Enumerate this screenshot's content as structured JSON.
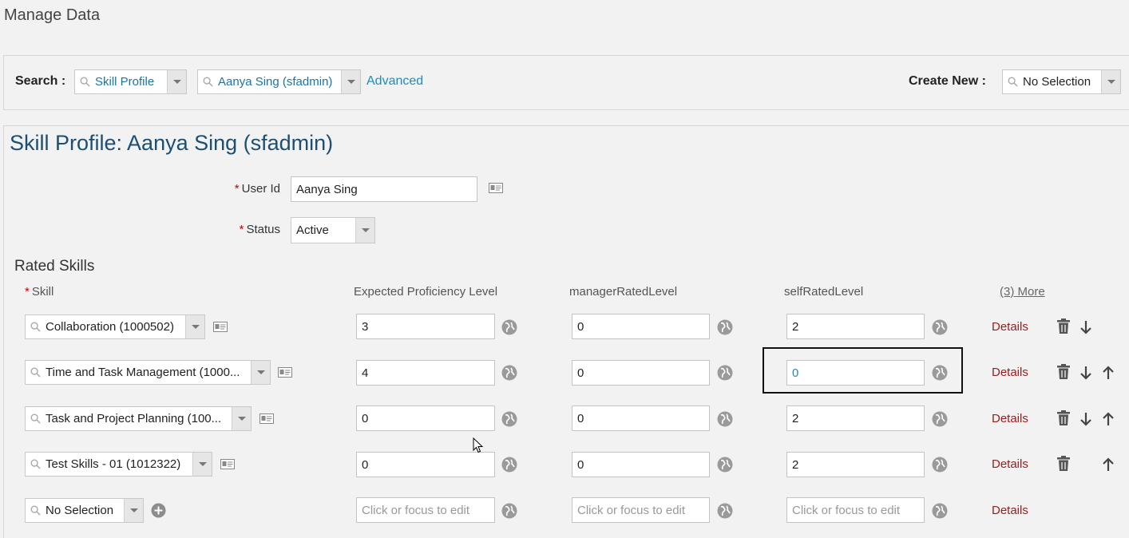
{
  "app": {
    "title": "Manage Data"
  },
  "search": {
    "label": "Search :",
    "type_value": "Skill Profile",
    "record_value": "Aanya Sing (sfadmin)",
    "advanced_label": "Advanced",
    "create_new_label": "Create New :",
    "create_new_value": "No Selection"
  },
  "profile": {
    "title": "Skill Profile: Aanya Sing (sfadmin)",
    "user_id_label": "User Id",
    "user_id_value": "Aanya Sing",
    "status_label": "Status",
    "status_value": "Active",
    "required_mark": "*"
  },
  "rated_skills": {
    "title": "Rated Skills",
    "columns": {
      "skill": "Skill",
      "expected": "Expected Proficiency Level",
      "manager": "managerRatedLevel",
      "self": "selfRatedLevel",
      "more": "(3) More"
    },
    "details_label": "Details",
    "placeholder": "Click or focus to edit",
    "rows": [
      {
        "skill": "Collaboration (1000502)",
        "expected": "3",
        "manager": "0",
        "self": "2"
      },
      {
        "skill": "Time and Task Management (1000...",
        "expected": "4",
        "manager": "0",
        "self": "0"
      },
      {
        "skill": "Task and Project Planning (100...",
        "expected": "0",
        "manager": "0",
        "self": "2"
      },
      {
        "skill": "Test Skills - 01 (1012322)",
        "expected": "0",
        "manager": "0",
        "self": "2"
      },
      {
        "skill": "No Selection",
        "expected": "",
        "manager": "",
        "self": ""
      }
    ]
  },
  "colors": {
    "link": "#1d8bc4",
    "title": "#1d4f73",
    "details": "#9a1b1b",
    "required": "#cc0000"
  }
}
